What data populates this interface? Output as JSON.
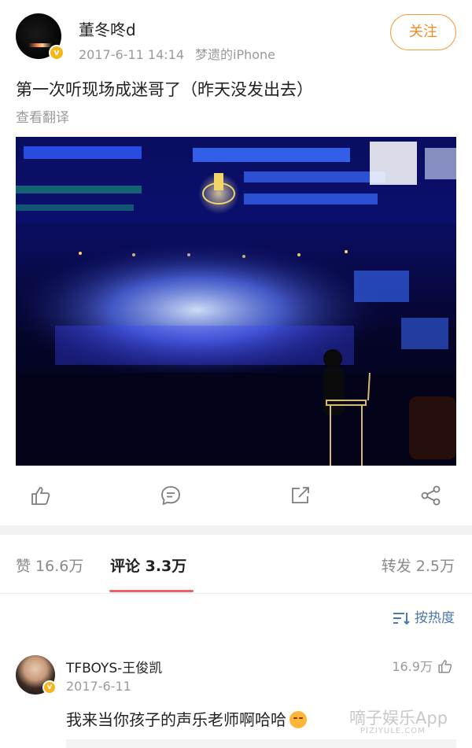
{
  "post": {
    "author_name": "董冬咚d",
    "timestamp": "2017-6-11 14:14",
    "source": "梦遗的iPhone",
    "follow_label": "关注",
    "verified_badge": "v",
    "text": "第一次听现场成迷哥了（昨天没发出去）",
    "translate_label": "查看翻译",
    "photo_alt": "concert-photo"
  },
  "actions": {
    "icons": [
      "thumbs-up-icon",
      "comment-icon",
      "repost-icon",
      "share-icon"
    ]
  },
  "tabs": {
    "likes_label": "赞 16.6万",
    "comments_label": "评论 3.3万",
    "reposts_label": "转发 2.5万"
  },
  "sort": {
    "label": "按热度",
    "icon": "sort-icon"
  },
  "comments": [
    {
      "user": "TFBOYS-王俊凯",
      "date": "2017-6-11",
      "likes": "16.9万",
      "text": "我来当你孩子的声乐老师啊哈哈",
      "emoji": "smirk-emoji"
    }
  ],
  "watermark": {
    "main": "嘀子娱乐App",
    "sub": "PIZIYULE.COM"
  },
  "colors": {
    "accent": "#f08a24",
    "tab_underline": "#f06060",
    "link": "#4a78b0",
    "badge": "#f6b619"
  }
}
